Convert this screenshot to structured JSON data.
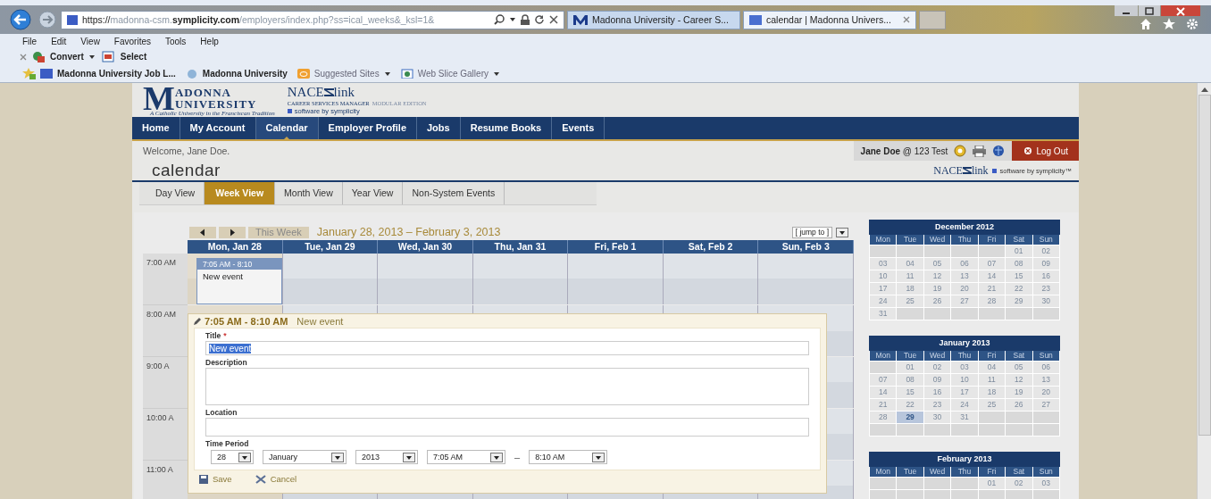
{
  "browser": {
    "address": {
      "scheme": "https://",
      "host_start": "madonna-csm.",
      "host_bold": "symplicity.com",
      "path": "/employers/index.php?ss=ical_weeks&_ksl=1&"
    },
    "tabs": [
      {
        "title": "Madonna University - Career S...",
        "selected": false
      },
      {
        "title": "calendar | Madonna Univers...",
        "selected": true
      }
    ],
    "menu": [
      "File",
      "Edit",
      "View",
      "Favorites",
      "Tools",
      "Help"
    ],
    "command_bar": [
      {
        "label": "Convert",
        "dropdown": true
      },
      {
        "label": "Select",
        "dropdown": false
      }
    ],
    "favorites": [
      {
        "label": "Madonna University Job L...",
        "dropdown": false,
        "muted": false
      },
      {
        "label": "Madonna University",
        "dropdown": false,
        "muted": false
      },
      {
        "label": "Suggested Sites",
        "dropdown": true,
        "muted": true
      },
      {
        "label": "Web Slice Gallery",
        "dropdown": true,
        "muted": true
      }
    ]
  },
  "site": {
    "logo": {
      "initial": "M",
      "line1": "ADONNA",
      "line2": "UNIVERSITY",
      "tagline": "A Catholic University in the Franciscan Tradition"
    },
    "product": {
      "name_start": "NACE",
      "name_end": "link",
      "subtitle": "CAREER SERVICES MANAGER",
      "edition": "MODULAR EDITION",
      "byline": "software by symplicity"
    },
    "nav": [
      {
        "label": "Home",
        "selected": false
      },
      {
        "label": "My Account",
        "selected": false
      },
      {
        "label": "Calendar",
        "selected": true
      },
      {
        "label": "Employer Profile",
        "selected": false
      },
      {
        "label": "Jobs",
        "selected": false
      },
      {
        "label": "Resume Books",
        "selected": false
      },
      {
        "label": "Events",
        "selected": false
      }
    ],
    "welcome": "Welcome, Jane Doe.",
    "user": {
      "name": "Jane Doe",
      "org": "@ 123 Test"
    },
    "logout": "Log Out",
    "page_title": "calendar",
    "partner": {
      "name_start": "NACE",
      "name_end": "link",
      "byline": "software by symplicity™"
    },
    "view_tabs": [
      {
        "label": "Day View",
        "selected": false
      },
      {
        "label": "Week View",
        "selected": true
      },
      {
        "label": "Month View",
        "selected": false
      },
      {
        "label": "Year View",
        "selected": false
      },
      {
        "label": "Non-System Events",
        "selected": false
      }
    ]
  },
  "week": {
    "this_week": "This Week",
    "range": "January 28, 2013 – February 3, 2013",
    "jump_to": "[ jump to ]",
    "days": [
      {
        "label": "Mon, Jan 28",
        "events": [
          {
            "time": "7:05 AM - 8:10",
            "title": "New event"
          }
        ]
      },
      {
        "label": "Tue, Jan 29"
      },
      {
        "label": "Wed, Jan 30"
      },
      {
        "label": "Thu, Jan 31"
      },
      {
        "label": "Fri, Feb 1"
      },
      {
        "label": "Sat, Feb 2"
      },
      {
        "label": "Sun, Feb 3"
      }
    ],
    "hours": [
      "7:00 AM",
      "8:00 AM",
      "9:00 A",
      "10:00 A",
      "11:00 A"
    ]
  },
  "event_editor": {
    "time": "7:05 AM - 8:10 AM",
    "title": "New event",
    "title_label": "Title",
    "required_mark": "*",
    "title_value": "New event",
    "title_value_selected": true,
    "description_label": "Description",
    "location_label": "Location",
    "time_period_label": "Time Period",
    "selects": [
      "28",
      "January",
      "2013",
      "7:05 AM",
      "8:10 AM"
    ],
    "separator": "–",
    "buttons": [
      {
        "kind": "save",
        "label": "Save"
      },
      {
        "kind": "cancel",
        "label": "Cancel"
      }
    ]
  },
  "mini_calendars": [
    {
      "title": "December 2012",
      "weekdays": [
        "Mon",
        "Tue",
        "Wed",
        "Thu",
        "Fri",
        "Sat",
        "Sun"
      ],
      "days": [
        {
          "kind": "blank"
        },
        {
          "kind": "blank"
        },
        {
          "kind": "blank"
        },
        {
          "kind": "blank"
        },
        {
          "kind": "blank"
        },
        {
          "day": "01",
          "selected": false
        },
        {
          "day": "02",
          "selected": false
        },
        {
          "day": "03",
          "selected": false
        },
        {
          "day": "04",
          "selected": false
        },
        {
          "day": "05",
          "selected": false
        },
        {
          "day": "06",
          "selected": false
        },
        {
          "day": "07",
          "selected": false
        },
        {
          "day": "08",
          "selected": false
        },
        {
          "day": "09",
          "selected": false
        },
        {
          "day": "10",
          "selected": false
        },
        {
          "day": "11",
          "selected": false
        },
        {
          "day": "12",
          "selected": false
        },
        {
          "day": "13",
          "selected": false
        },
        {
          "day": "14",
          "selected": false
        },
        {
          "day": "15",
          "selected": false
        },
        {
          "day": "16",
          "selected": false
        },
        {
          "day": "17",
          "selected": false
        },
        {
          "day": "18",
          "selected": false
        },
        {
          "day": "19",
          "selected": false
        },
        {
          "day": "20",
          "selected": false
        },
        {
          "day": "21",
          "selected": false
        },
        {
          "day": "22",
          "selected": false
        },
        {
          "day": "23",
          "selected": false
        },
        {
          "day": "24",
          "selected": false
        },
        {
          "day": "25",
          "selected": false
        },
        {
          "day": "26",
          "selected": false
        },
        {
          "day": "27",
          "selected": false
        },
        {
          "day": "28",
          "selected": false
        },
        {
          "day": "29",
          "selected": false
        },
        {
          "day": "30",
          "selected": false
        },
        {
          "day": "31",
          "selected": false
        }
      ]
    },
    {
      "title": "January 2013",
      "weekdays": [
        "Mon",
        "Tue",
        "Wed",
        "Thu",
        "Fri",
        "Sat",
        "Sun"
      ],
      "days": [
        {
          "kind": "blank"
        },
        {
          "day": "01",
          "selected": false
        },
        {
          "day": "02",
          "selected": false
        },
        {
          "day": "03",
          "selected": false
        },
        {
          "day": "04",
          "selected": false
        },
        {
          "day": "05",
          "selected": false
        },
        {
          "day": "06",
          "selected": false
        },
        {
          "day": "07",
          "selected": false
        },
        {
          "day": "08",
          "selected": false
        },
        {
          "day": "09",
          "selected": false
        },
        {
          "day": "10",
          "selected": false
        },
        {
          "day": "11",
          "selected": false
        },
        {
          "day": "12",
          "selected": false
        },
        {
          "day": "13",
          "selected": false
        },
        {
          "day": "14",
          "selected": false
        },
        {
          "day": "15",
          "selected": false
        },
        {
          "day": "16",
          "selected": false
        },
        {
          "day": "17",
          "selected": false
        },
        {
          "day": "18",
          "selected": false
        },
        {
          "day": "19",
          "selected": false
        },
        {
          "day": "20",
          "selected": false
        },
        {
          "day": "21",
          "selected": false
        },
        {
          "day": "22",
          "selected": false
        },
        {
          "day": "23",
          "selected": false
        },
        {
          "day": "24",
          "selected": false
        },
        {
          "day": "25",
          "selected": false
        },
        {
          "day": "26",
          "selected": false
        },
        {
          "day": "27",
          "selected": false
        },
        {
          "day": "28",
          "selected": false
        },
        {
          "day": "29",
          "selected": true
        },
        {
          "day": "30",
          "selected": false
        },
        {
          "day": "31",
          "selected": false
        }
      ]
    },
    {
      "title": "February 2013",
      "weekdays": [
        "Mon",
        "Tue",
        "Wed",
        "Thu",
        "Fri",
        "Sat",
        "Sun"
      ],
      "days": [
        {
          "kind": "blank"
        },
        {
          "kind": "blank"
        },
        {
          "kind": "blank"
        },
        {
          "kind": "blank"
        },
        {
          "day": "01",
          "selected": false
        },
        {
          "day": "02",
          "selected": false
        },
        {
          "day": "03",
          "selected": false
        }
      ]
    }
  ]
}
